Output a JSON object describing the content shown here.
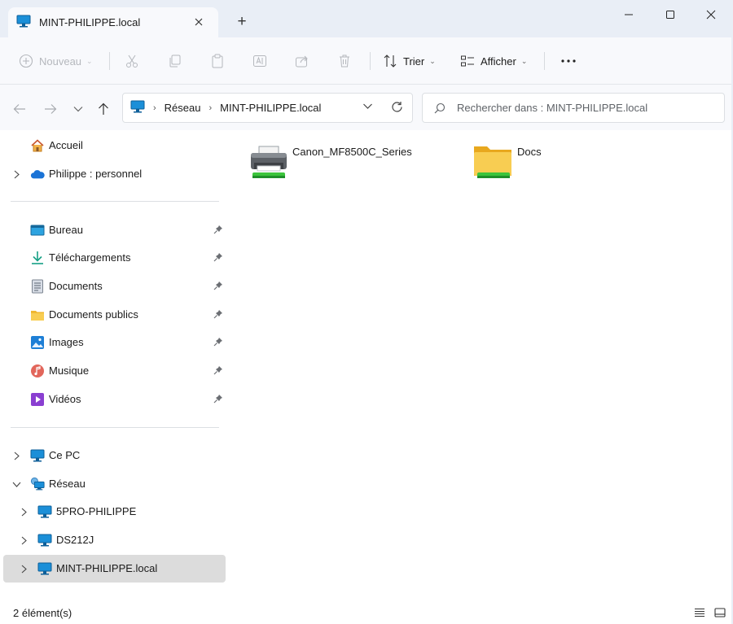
{
  "tab": {
    "title": "MINT-PHILIPPE.local",
    "close_icon": "close-icon",
    "new_tab_symbol": "+"
  },
  "window": {
    "minimize_icon": "minimize-icon",
    "maximize_icon": "maximize-icon",
    "close_icon": "close-icon"
  },
  "toolbar": {
    "new_label": "Nouveau",
    "sort_label": "Trier",
    "view_label": "Afficher",
    "more_icon": "more-icon"
  },
  "address": {
    "crumbs": [
      "Réseau",
      "MINT-PHILIPPE.local"
    ],
    "search_placeholder": "Rechercher dans : MINT-PHILIPPE.local"
  },
  "sidebar": {
    "top": [
      {
        "label": "Accueil",
        "icon": "home-icon"
      },
      {
        "label": "Philippe : personnel",
        "icon": "onedrive-cloud-icon"
      }
    ],
    "pinned": [
      {
        "label": "Bureau",
        "icon": "desktop-icon"
      },
      {
        "label": "Téléchargements",
        "icon": "download-icon"
      },
      {
        "label": "Documents",
        "icon": "documents-icon"
      },
      {
        "label": "Documents publics",
        "icon": "folder-icon"
      },
      {
        "label": "Images",
        "icon": "pictures-icon"
      },
      {
        "label": "Musique",
        "icon": "music-icon"
      },
      {
        "label": "Vidéos",
        "icon": "videos-icon"
      }
    ],
    "bottom": [
      {
        "label": "Ce PC",
        "icon": "pc-icon"
      },
      {
        "label": "Réseau",
        "icon": "network-icon"
      },
      {
        "label": "5PRO-PHILIPPE",
        "icon": "computer-icon"
      },
      {
        "label": "DS212J",
        "icon": "computer-icon"
      },
      {
        "label": "MINT-PHILIPPE.local",
        "icon": "computer-icon",
        "selected": true
      }
    ]
  },
  "content": {
    "items": [
      {
        "name": "Canon_MF8500C_Series",
        "icon": "printer-icon"
      },
      {
        "name": "Docs",
        "icon": "shared-folder-icon"
      }
    ]
  },
  "status": {
    "count_text": "2 élément(s)"
  },
  "colors": {
    "accent": "#0067c0",
    "titlebar": "#e9eef6",
    "selected": "#dcdcdc",
    "folder": "#f8c33b",
    "share_green": "#3cc43c"
  }
}
